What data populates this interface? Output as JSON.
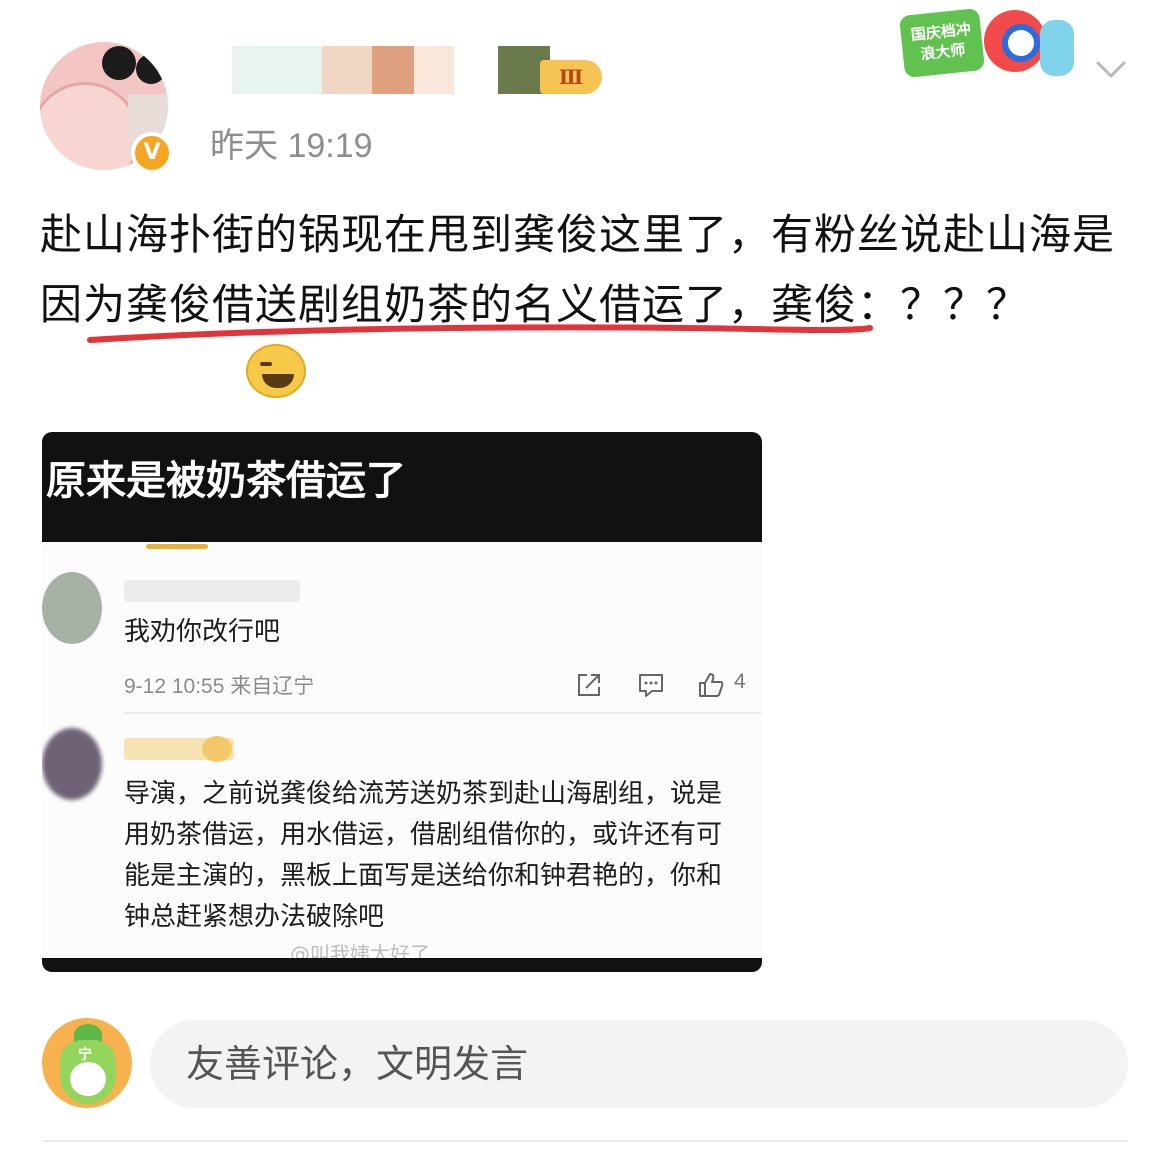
{
  "post": {
    "timestamp": "昨天 19:19",
    "level_badge": "Ⅲ",
    "verified_badge": "V",
    "text": "赴山海扑街的锅现在甩到龚俊这里了，有粉丝说赴山海是因为龚俊借送剧组奶茶的名义借运了，龚俊：？？？",
    "emoji": "grinning-sweat-emoji"
  },
  "event_badge": {
    "text": "国庆档冲浪大师"
  },
  "icons": {
    "chevron": "chevron-down-icon"
  },
  "embed": {
    "title": "原来是被奶茶借运了",
    "comments": [
      {
        "text": "我劝你改行吧",
        "meta": "9-12 10:55  来自辽宁",
        "likes": "4"
      },
      {
        "text": "导演，之前说龚俊给流芳送奶茶到赴山海剧组，说是用奶茶借运，用水借运，借剧组借你的，或许还有可能是主演的，黑板上面写是送给你和钟君艳的，你和钟总赶紧想办法破除吧"
      }
    ],
    "watermark": "@叫我姨太好了"
  },
  "composer": {
    "placeholder": "友善评论，文明发言",
    "avatar_tag": "宁"
  },
  "colors": {
    "accent_underline": "#e0353b",
    "badge_orange": "#f5a623",
    "meta_gray": "#8e8e8e"
  }
}
